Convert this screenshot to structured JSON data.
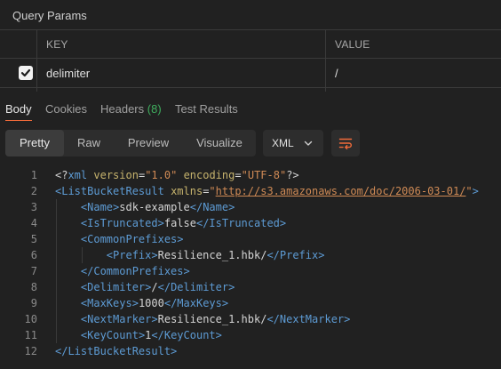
{
  "query_params": {
    "title": "Query Params",
    "headers": {
      "key": "KEY",
      "value": "VALUE"
    },
    "rows": [
      {
        "checked": true,
        "key": "delimiter",
        "value": "/"
      }
    ]
  },
  "response_tabs": {
    "body": "Body",
    "cookies": "Cookies",
    "headers": "Headers",
    "headers_count": "(8)",
    "test_results": "Test Results",
    "active": "Body"
  },
  "view_modes": [
    "Pretty",
    "Raw",
    "Preview",
    "Visualize"
  ],
  "active_view": "Pretty",
  "format": {
    "selected": "XML"
  },
  "icons": {
    "check": "check-icon",
    "chevron": "chevron-down-icon",
    "wrap": "wrap-lines-icon"
  },
  "colors": {
    "accent": "#f26b3a",
    "tag": "#5d9bd4",
    "attr": "#c6b36d",
    "string": "#cf8a55",
    "count": "#3fae5e"
  },
  "code_lines": [
    {
      "n": "1",
      "t": "<?xml version=\"1.0\" encoding=\"UTF-8\"?>"
    },
    {
      "n": "2",
      "t": "<ListBucketResult xmlns=\"http://s3.amazonaws.com/doc/2006-03-01/\">"
    },
    {
      "n": "3",
      "t": "    <Name>sdk-example</Name>"
    },
    {
      "n": "4",
      "t": "    <IsTruncated>false</IsTruncated>"
    },
    {
      "n": "5",
      "t": "    <CommonPrefixes>"
    },
    {
      "n": "6",
      "t": "        <Prefix>Resilience_1.hbk/</Prefix>"
    },
    {
      "n": "7",
      "t": "    </CommonPrefixes>"
    },
    {
      "n": "8",
      "t": "    <Delimiter>/</Delimiter>"
    },
    {
      "n": "9",
      "t": "    <MaxKeys>1000</MaxKeys>"
    },
    {
      "n": "10",
      "t": "    <NextMarker>Resilience_1.hbk/</NextMarker>"
    },
    {
      "n": "11",
      "t": "    <KeyCount>1</KeyCount>"
    },
    {
      "n": "12",
      "t": "</ListBucketResult>"
    }
  ]
}
